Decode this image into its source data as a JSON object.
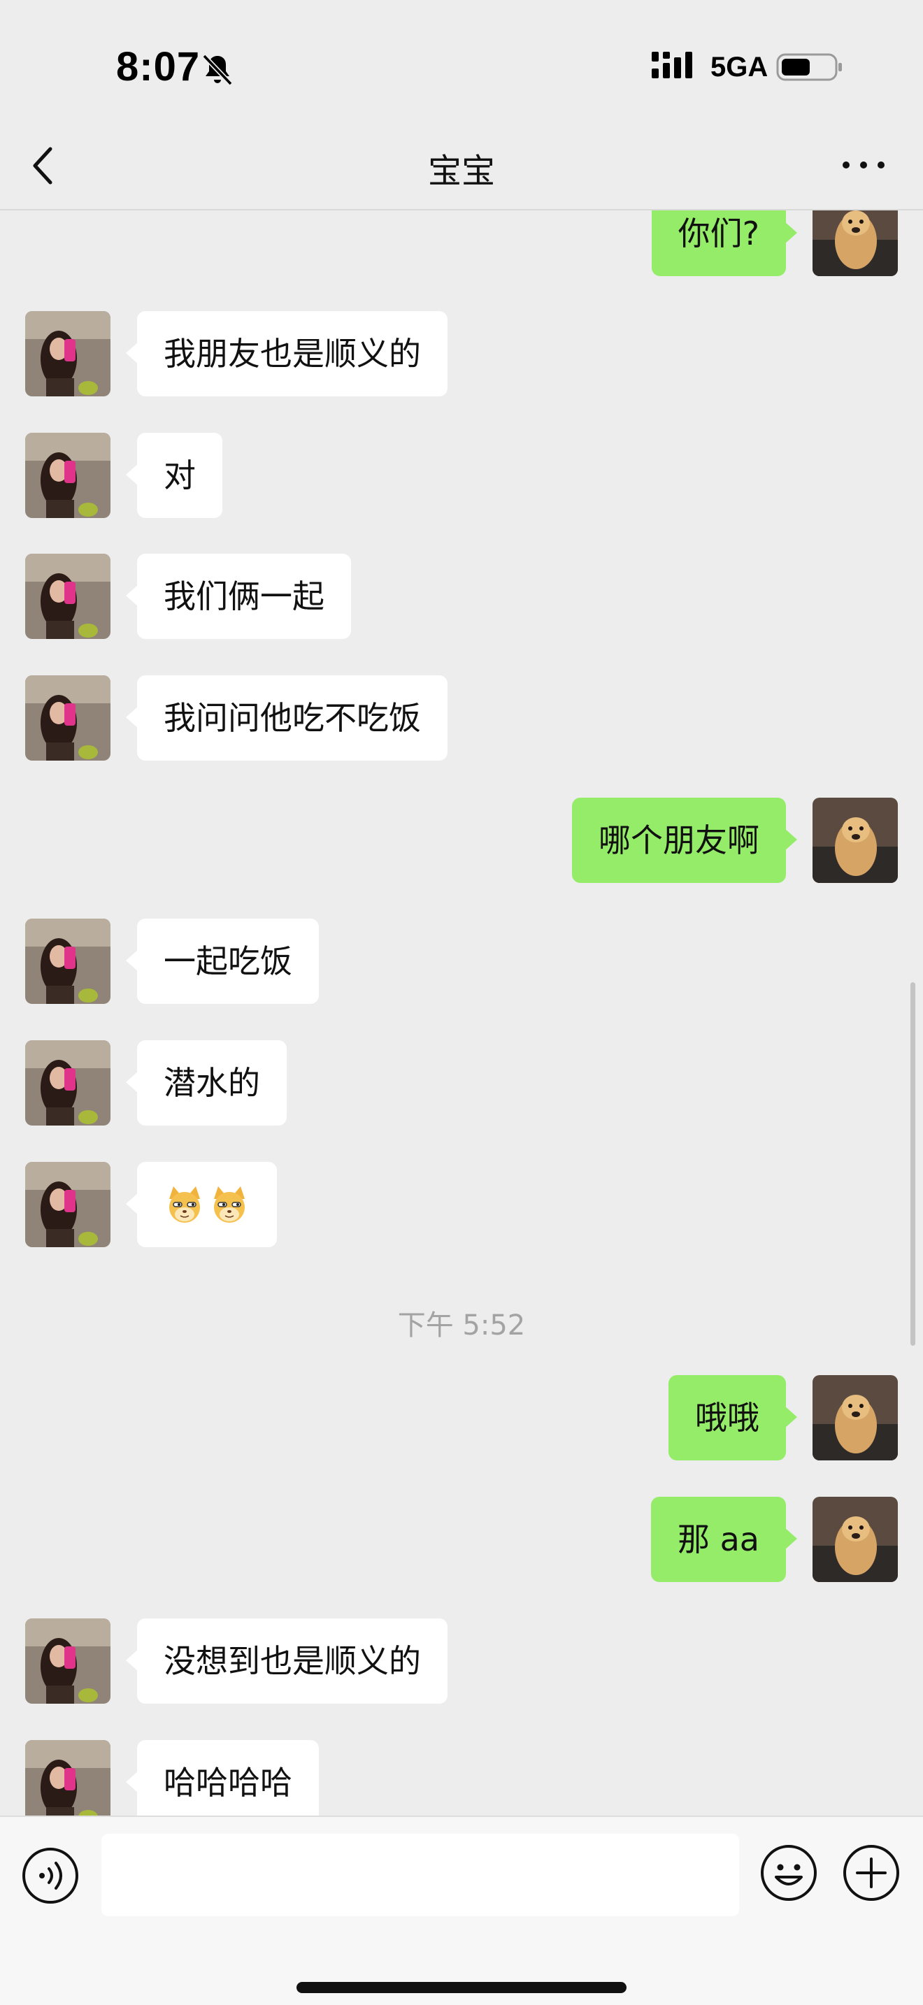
{
  "status_bar": {
    "time": "8:07",
    "network": "5GA",
    "icons": [
      "bell-slash-icon",
      "signal-bars-icon",
      "battery-icon"
    ]
  },
  "nav": {
    "title": "宝宝",
    "back_icon": "chevron-left-icon",
    "more_icon": "ellipsis-icon"
  },
  "messages": [
    {
      "side": "out",
      "text": "你们?"
    },
    {
      "side": "in",
      "text": "我朋友也是顺义的"
    },
    {
      "side": "in",
      "text": "对"
    },
    {
      "side": "in",
      "text": "我们俩一起"
    },
    {
      "side": "in",
      "text": "我问问他吃不吃饭"
    },
    {
      "side": "out",
      "text": "哪个朋友啊"
    },
    {
      "side": "in",
      "text": "一起吃饭"
    },
    {
      "side": "in",
      "text": "潜水的"
    },
    {
      "side": "in",
      "text": "",
      "sticker": "doge-emoji-pair"
    },
    {
      "side": "out",
      "text": "哦哦"
    },
    {
      "side": "out",
      "text": "那 aa"
    },
    {
      "side": "in",
      "text": "没想到也是顺义的"
    },
    {
      "side": "in",
      "text": "哈哈哈哈"
    }
  ],
  "time_divider": "下午 5:52",
  "input_bar": {
    "placeholder": "",
    "icons": [
      "voice-icon",
      "emoji-icon",
      "plus-icon"
    ]
  },
  "colors": {
    "background": "#ededed",
    "outgoing_bubble": "#95ec69",
    "incoming_bubble": "#ffffff",
    "timestamp": "#a3a3a3"
  }
}
